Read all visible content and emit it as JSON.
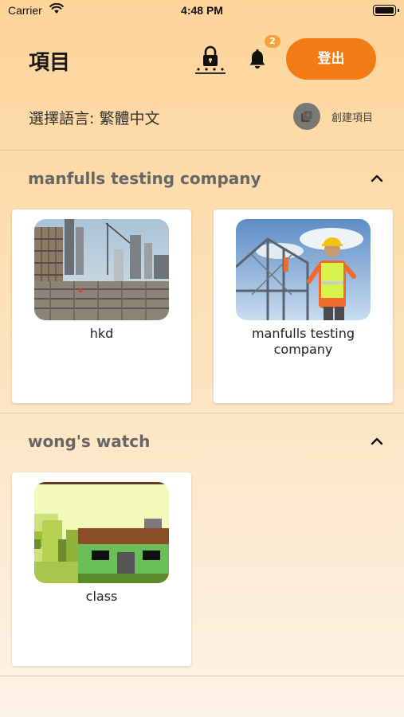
{
  "status_bar": {
    "carrier": "Carrier",
    "time": "4:48 PM"
  },
  "header": {
    "title": "項目",
    "notification_count": "2",
    "logout_label": "登出"
  },
  "toolbar": {
    "language_label": "選擇語言: 繁體中文",
    "create_label": "創建項目"
  },
  "sections": [
    {
      "title": "manfulls testing company",
      "projects": [
        {
          "name": "hkd",
          "image": "construction-site-photo"
        },
        {
          "name": "manfulls testing company",
          "image": "construction-worker-photo"
        }
      ]
    },
    {
      "title": "wong's watch",
      "projects": [
        {
          "name": "class",
          "image": "pixel-house-image"
        }
      ]
    }
  ],
  "colors": {
    "accent": "#f37a15",
    "badge": "#f6a23b"
  }
}
